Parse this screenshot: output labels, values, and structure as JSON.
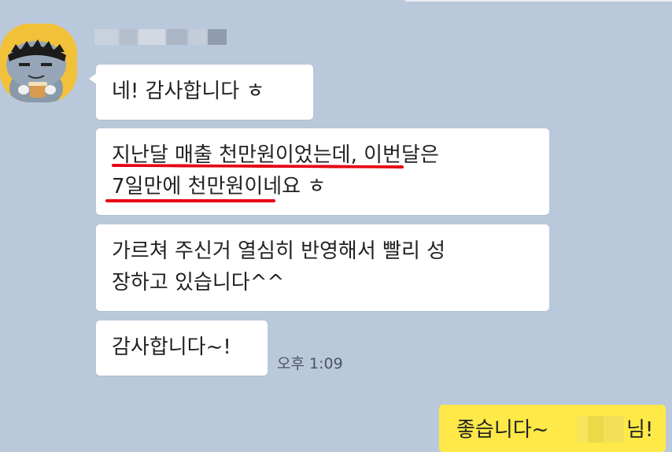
{
  "chat": {
    "sender_name": "",
    "messages": [
      {
        "text": "네! 감사합니다 ㅎ"
      },
      {
        "line1": "지난달 매출 천만원이었는데, 이번달은",
        "line2": "7일만에 천만원이네요 ㅎ"
      },
      {
        "line1": "가르쳐 주신거 열심히 반영해서 빨리 성",
        "line2": "장하고 있습니다^^"
      },
      {
        "text": "감사합니다~!"
      }
    ],
    "timestamp": "오후 1:09",
    "my_message": {
      "prefix": "좋습니다~ ",
      "suffix": "님!"
    }
  },
  "colors": {
    "background": "#b9c8da",
    "incoming_bubble": "#ffffff",
    "outgoing_bubble": "#fee948",
    "highlight_underline": "#e60012",
    "avatar_background": "#f2c13a"
  },
  "icons": {
    "avatar": "profile-cat-character-icon"
  }
}
